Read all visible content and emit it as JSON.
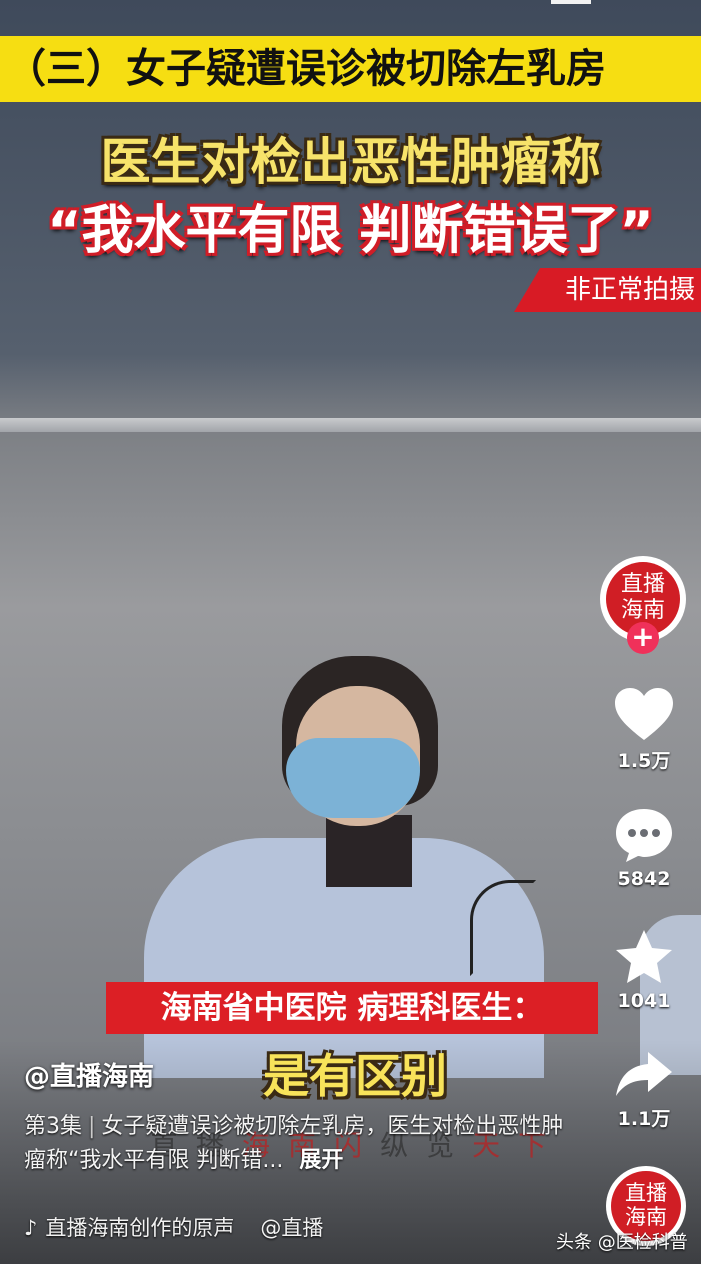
{
  "banner": {
    "title": "（三）女子疑遭误诊被切除左乳房"
  },
  "headline": {
    "line1": "医生对检出恶性肿瘤称",
    "line2": "“我水平有限 判断错误了”"
  },
  "tag": {
    "text": "非正常拍摄"
  },
  "caption": {
    "speaker": "海南省中医院 病理科医生：",
    "speech": "是有区别"
  },
  "watermark": {
    "text": [
      "直",
      "播",
      "海",
      "南",
      "闪",
      "纵",
      "览",
      "天",
      "下"
    ]
  },
  "rail": {
    "avatar_text": "直播\n海南",
    "follow_label": "+",
    "like_count": "1.5万",
    "comment_count": "5842",
    "favorite_count": "1041",
    "share_count": "1.1万"
  },
  "info": {
    "author": "@直播海南",
    "episode": "第3集",
    "description": "女子疑遭误诊被切除左乳房，医生对检出恶性肿瘤称“我水平有限 判断错...",
    "expand": "展开",
    "music": "直播海南创作的原声",
    "mention": "@直播"
  },
  "source": {
    "text": "头条 @医检科普"
  },
  "colors": {
    "banner_yellow": "#f6de12",
    "accent_red": "#d81b25",
    "follow_pink": "#f0315a"
  }
}
